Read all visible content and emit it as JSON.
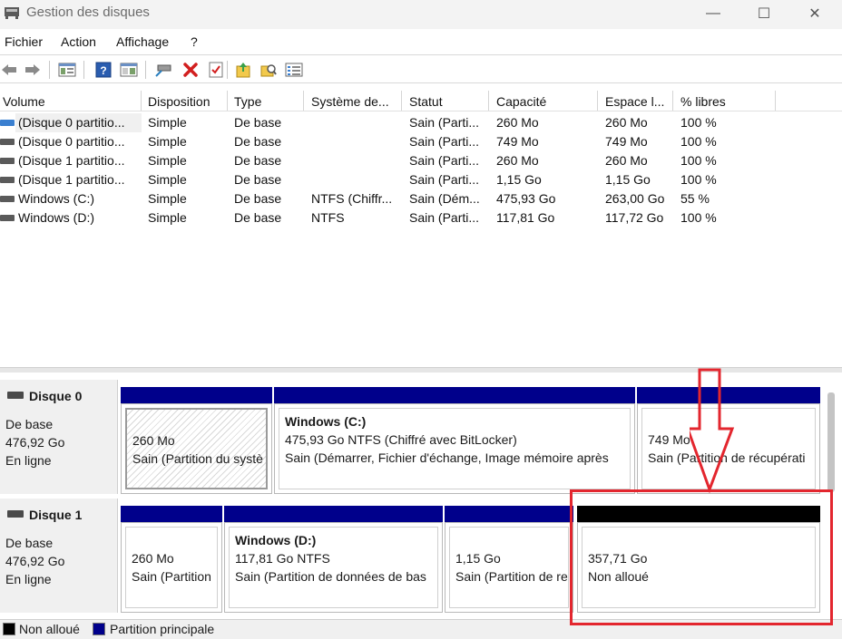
{
  "window": {
    "title": "Gestion des disques",
    "buttons": {
      "minimize": "—",
      "maximize": "☐",
      "close": "✕"
    }
  },
  "menu": [
    "Fichier",
    "Action",
    "Affichage",
    "?"
  ],
  "toolbar_icons": [
    "back-icon",
    "forward-icon",
    "console-tree-icon",
    "help-icon",
    "properties-icon",
    "connect-drive-icon",
    "delete-icon",
    "checklist-icon",
    "upload-icon",
    "search-folder-icon",
    "list-view-icon"
  ],
  "list": {
    "columns": [
      "Volume",
      "Disposition",
      "Type",
      "Système de...",
      "Statut",
      "Capacité",
      "Espace l...",
      "% libres"
    ],
    "rows": [
      [
        "(Disque 0 partitio...",
        "Simple",
        "De base",
        "",
        "Sain (Parti...",
        "260 Mo",
        "260 Mo",
        "100 %"
      ],
      [
        "(Disque 0 partitio...",
        "Simple",
        "De base",
        "",
        "Sain (Parti...",
        "749 Mo",
        "749 Mo",
        "100 %"
      ],
      [
        "(Disque 1 partitio...",
        "Simple",
        "De base",
        "",
        "Sain (Parti...",
        "260 Mo",
        "260 Mo",
        "100 %"
      ],
      [
        "(Disque 1 partitio...",
        "Simple",
        "De base",
        "",
        "Sain (Parti...",
        "1,15 Go",
        "1,15 Go",
        "100 %"
      ],
      [
        "Windows (C:)",
        "Simple",
        "De base",
        "NTFS (Chiffr...",
        "Sain (Dém...",
        "475,93 Go",
        "263,00 Go",
        "55 %"
      ],
      [
        "Windows (D:)",
        "Simple",
        "De base",
        "NTFS",
        "Sain (Parti...",
        "117,81 Go",
        "117,72 Go",
        "100 %"
      ]
    ]
  },
  "disks": [
    {
      "name": "Disque 0",
      "type": "De base",
      "size": "476,92 Go",
      "status": "En ligne",
      "partitions": [
        {
          "title": "",
          "line1": "260 Mo",
          "line2": "Sain (Partition du systè",
          "bar": "#00008b"
        },
        {
          "title": "Windows  (C:)",
          "line1": "475,93 Go NTFS (Chiffré avec BitLocker)",
          "line2": "Sain (Démarrer, Fichier d'échange, Image mémoire après",
          "bar": "#00008b"
        },
        {
          "title": "",
          "line1": "749 Mo",
          "line2": "Sain (Partition de récupérati",
          "bar": "#00008b"
        }
      ]
    },
    {
      "name": "Disque 1",
      "type": "De base",
      "size": "476,92 Go",
      "status": "En ligne",
      "partitions": [
        {
          "title": "",
          "line1": "260 Mo",
          "line2": "Sain (Partition",
          "bar": "#00008b"
        },
        {
          "title": "Windows  (D:)",
          "line1": "117,81 Go NTFS",
          "line2": "Sain (Partition de données de bas",
          "bar": "#00008b"
        },
        {
          "title": "",
          "line1": "1,15 Go",
          "line2": "Sain (Partition de re",
          "bar": "#00008b"
        },
        {
          "title": "",
          "line1": "357,71 Go",
          "line2": "Non alloué",
          "bar": "#000000"
        }
      ]
    }
  ],
  "legend": [
    {
      "label": "Non alloué",
      "color": "#000000"
    },
    {
      "label": "Partition principale",
      "color": "#00008b"
    }
  ],
  "annotation": {
    "color": "#e3262e"
  }
}
